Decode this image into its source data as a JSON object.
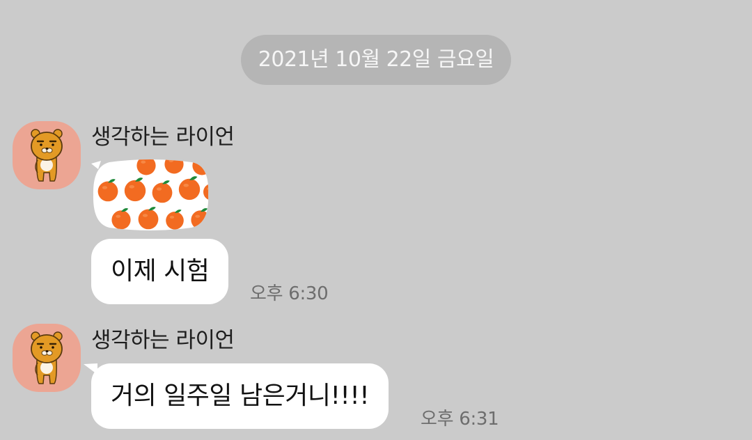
{
  "date_divider": "2021년 10월 22일 금요일",
  "groups": [
    {
      "sender": "생각하는 라이언",
      "avatar_icon": "ryan-character-icon",
      "emoticon_icon": "orange-pattern-emoticon",
      "message": "이제 시험",
      "time": "오후 6:30"
    },
    {
      "sender": "생각하는 라이언",
      "avatar_icon": "ryan-character-icon",
      "message": "거의 일주일 남은거니!!!!",
      "time": "오후 6:31"
    }
  ],
  "colors": {
    "background": "#cbcbcb",
    "date_pill": "#b5b5b5",
    "bubble": "#ffffff",
    "avatar_bg": "#eca593",
    "orange": "#f26b21"
  }
}
